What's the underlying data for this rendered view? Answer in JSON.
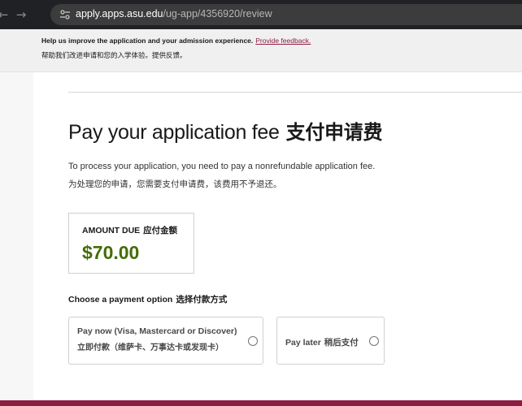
{
  "browser": {
    "url_host": "apply.apps.asu.edu",
    "url_path": "/ug-app/4356920/review",
    "nav_back_icon": "arrow-left-icon",
    "nav_forward_icon": "arrow-right-icon",
    "site_info_icon": "tune-icon"
  },
  "feedback_banner": {
    "text_en": "Help us improve the application and your admission experience.",
    "link_text": "Provide feedback.",
    "text_zh": "帮助我们改进申请和您的入学体验。提供反馈。"
  },
  "page": {
    "title_en": "Pay your application fee",
    "title_zh": "支付申请费",
    "description_en": "To process your application, you need to pay a nonrefundable application fee.",
    "description_zh": "为处理您的申请，您需要支付申请费，该费用不予退还。"
  },
  "amount": {
    "label_en": "AMOUNT DUE",
    "label_zh": "应付金额",
    "value": "$70.00",
    "value_color": "#446c08"
  },
  "payment": {
    "heading_en": "Choose a payment option",
    "heading_zh": "选择付款方式",
    "options": [
      {
        "label_en": "Pay now (Visa, Mastercard or Discover)",
        "label_zh": "立即付款（维萨卡、万事达卡或发现卡）"
      },
      {
        "label_en": "Pay later",
        "label_zh": "稍后支付"
      }
    ]
  },
  "theme": {
    "accent": "#8c1d40",
    "browser_bg": "#202124"
  }
}
